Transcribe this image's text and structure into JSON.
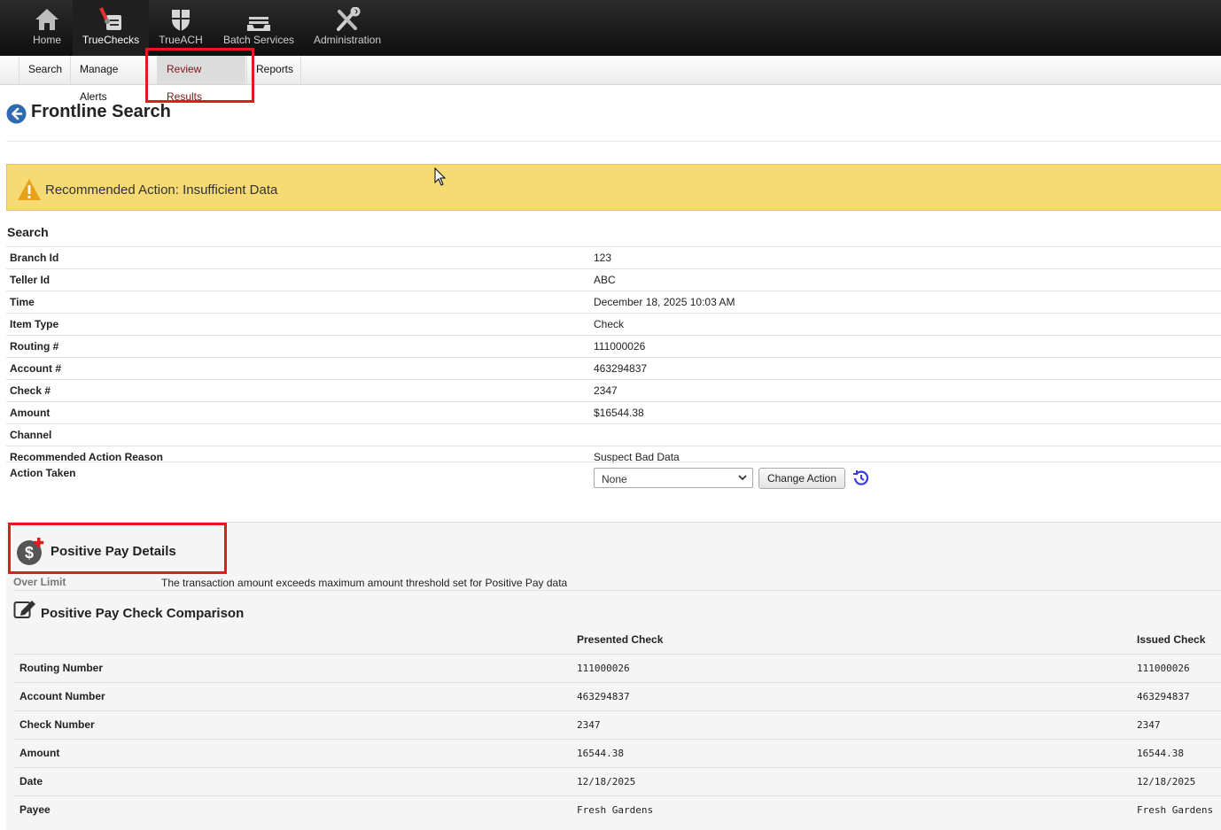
{
  "topnav": {
    "items": [
      {
        "label": "Home",
        "icon": "home-icon"
      },
      {
        "label": "TrueChecks",
        "icon": "checks-icon",
        "active": true
      },
      {
        "label": "TrueACH",
        "icon": "shield-icon"
      },
      {
        "label": "Batch Services",
        "icon": "inbox-tray-icon"
      },
      {
        "label": "Administration",
        "icon": "tools-icon"
      }
    ]
  },
  "subnav": {
    "tabs": [
      {
        "label": "Search"
      },
      {
        "label": "Manage Alerts"
      },
      {
        "label": "Review Results",
        "active": true
      },
      {
        "label": "Reports"
      }
    ]
  },
  "page": {
    "title": "Frontline Search"
  },
  "banner": {
    "text": "Recommended Action: Insufficient Data",
    "color": "#f6da74"
  },
  "search": {
    "title": "Search",
    "rows": [
      {
        "label": "Branch Id",
        "value": "123"
      },
      {
        "label": "Teller Id",
        "value": "ABC"
      },
      {
        "label": "Time",
        "value": "December 18, 2025 10:03 AM"
      },
      {
        "label": "Item Type",
        "value": "Check"
      },
      {
        "label": "Routing #",
        "value": "111000026"
      },
      {
        "label": "Account #",
        "value": "463294837"
      },
      {
        "label": "Check #",
        "value": "2347"
      },
      {
        "label": "Amount",
        "value": "$16544.38"
      },
      {
        "label": "Channel",
        "value": ""
      },
      {
        "label": "Recommended Action Reason",
        "value": "Suspect Bad Data"
      }
    ],
    "action_taken_label": "Action Taken",
    "action_select_value": "None",
    "change_action_label": "Change Action"
  },
  "positive_pay": {
    "title": "Positive Pay Details",
    "over_limit_label": "Over Limit",
    "over_limit_text": "The transaction amount exceeds maximum amount threshold set for Positive Pay data",
    "comparison_title": "Positive Pay Check Comparison",
    "col_presented": "Presented Check",
    "col_issued": "Issued Check",
    "rows": [
      {
        "label": "Routing Number",
        "presented": "111000026",
        "issued": "111000026"
      },
      {
        "label": "Account Number",
        "presented": "463294837",
        "issued": "463294837"
      },
      {
        "label": "Check Number",
        "presented": "2347",
        "issued": "2347"
      },
      {
        "label": "Amount",
        "presented": "16544.38",
        "issued": "16544.38"
      },
      {
        "label": "Date",
        "presented": "12/18/2025",
        "issued": "12/18/2025"
      },
      {
        "label": "Payee",
        "presented": "Fresh Gardens",
        "issued": "Fresh Gardens"
      }
    ]
  }
}
